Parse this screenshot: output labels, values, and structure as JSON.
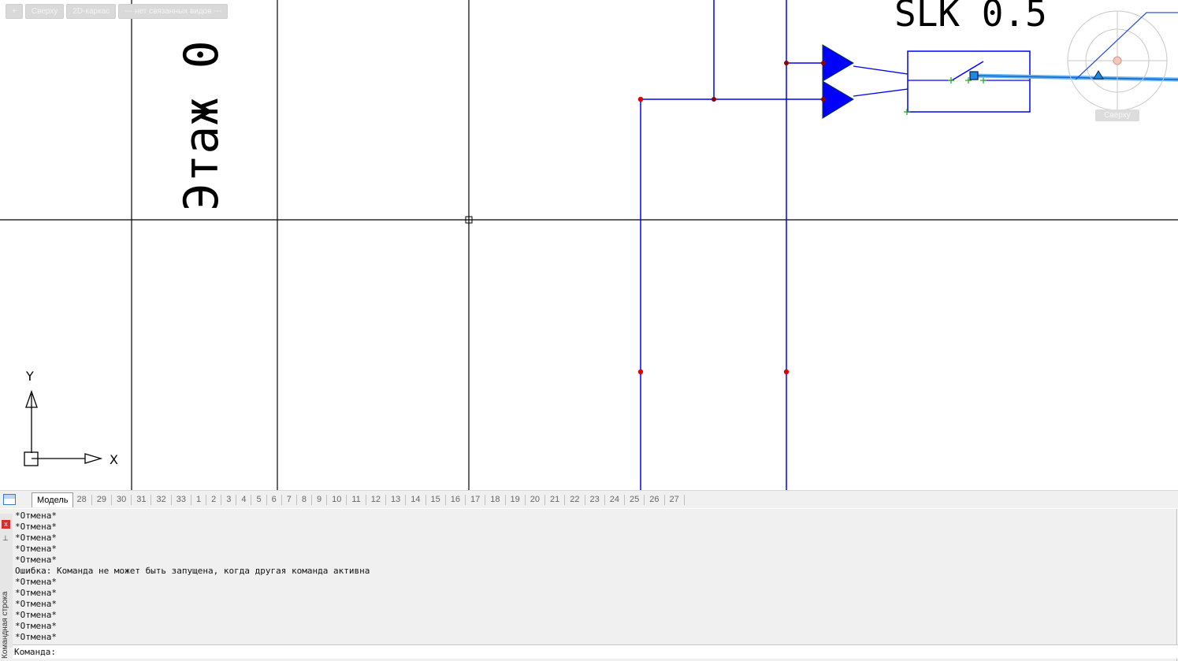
{
  "viewport_controls": {
    "plus": "+",
    "view": "Сверху",
    "style": "2D-каркас",
    "linked": "--- нет связанных видов ---"
  },
  "drawing": {
    "text_vertical": "Этаж 0",
    "text_top": "SLK 0.5",
    "ucs_x": "X",
    "ucs_y": "Y",
    "colors": {
      "wire": "#0000ff",
      "grid": "#000000",
      "node": "#ff0000",
      "highlight": "#1e88e5"
    }
  },
  "navcube": {
    "label": "Сверху"
  },
  "tabs": {
    "model": "Модель",
    "layouts": [
      "28",
      "29",
      "30",
      "31",
      "32",
      "33",
      "1",
      "2",
      "3",
      "4",
      "5",
      "6",
      "7",
      "8",
      "9",
      "10",
      "11",
      "12",
      "13",
      "14",
      "15",
      "16",
      "17",
      "18",
      "19",
      "20",
      "21",
      "22",
      "23",
      "24",
      "25",
      "26",
      "27"
    ]
  },
  "command_line": {
    "side_label": "Командная строка",
    "close": "x",
    "history": [
      "*Отмена*",
      "*Отмена*",
      "*Отмена*",
      "*Отмена*",
      "*Отмена*",
      "Ошибка: Команда не может быть запущена, когда другая команда активна",
      "*Отмена*",
      "*Отмена*",
      "*Отмена*",
      "*Отмена*",
      "*Отмена*",
      "*Отмена*"
    ],
    "prompt": "Команда:",
    "input_value": ""
  }
}
